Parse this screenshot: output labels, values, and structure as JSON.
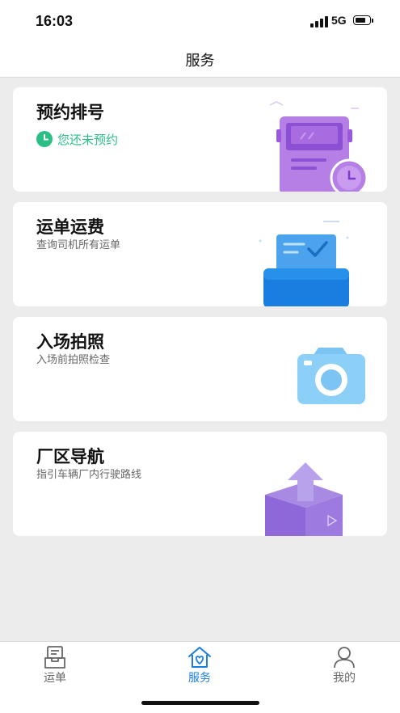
{
  "status_bar": {
    "time": "16:03",
    "network": "5G"
  },
  "header": {
    "title": "服务"
  },
  "cards": [
    {
      "title": "预约排号",
      "status_text": "您还未预约",
      "illustration": "truck-clock-illustration"
    },
    {
      "title": "运单运费",
      "subtitle": "查询司机所有运单",
      "illustration": "waybill-tray-illustration"
    },
    {
      "title": "入场拍照",
      "subtitle": "入场前拍照检查",
      "illustration": "camera-illustration"
    },
    {
      "title": "厂区导航",
      "subtitle": "指引车辆厂内行驶路线",
      "illustration": "box-arrow-illustration"
    }
  ],
  "tabbar": {
    "items": [
      {
        "label": "运单",
        "icon": "waybill-icon",
        "active": false
      },
      {
        "label": "服务",
        "icon": "service-heart-home-icon",
        "active": true
      },
      {
        "label": "我的",
        "icon": "user-icon",
        "active": false
      }
    ]
  },
  "colors": {
    "accent": "#1a7ee0",
    "status_green": "#2bbf86",
    "inactive_tab": "#666666",
    "background": "#ececec"
  }
}
